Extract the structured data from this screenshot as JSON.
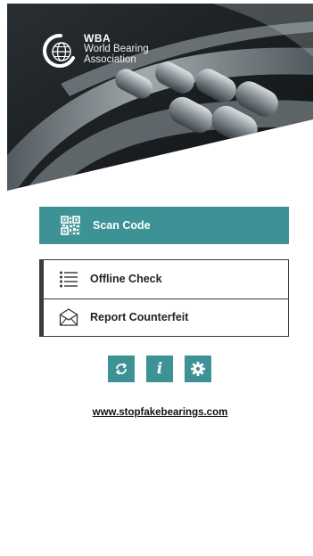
{
  "header": {
    "brand_abbr": "WBA",
    "brand_line1": "World Bearing",
    "brand_line2": "Association"
  },
  "scan": {
    "label": "Scan Code",
    "icon": "qr-code-icon"
  },
  "options": [
    {
      "label": "Offline Check",
      "icon": "list-icon"
    },
    {
      "label": "Report Counterfeit",
      "icon": "envelope-icon"
    }
  ],
  "toolbar": {
    "sync_icon": "sync-icon",
    "info_label": "i",
    "settings_icon": "gear-icon"
  },
  "footer": {
    "website": "www.stopfakebearings.com"
  },
  "colors": {
    "accent": "#3d9296",
    "border": "#3b3b3b",
    "header_dark": "#1c2125"
  }
}
